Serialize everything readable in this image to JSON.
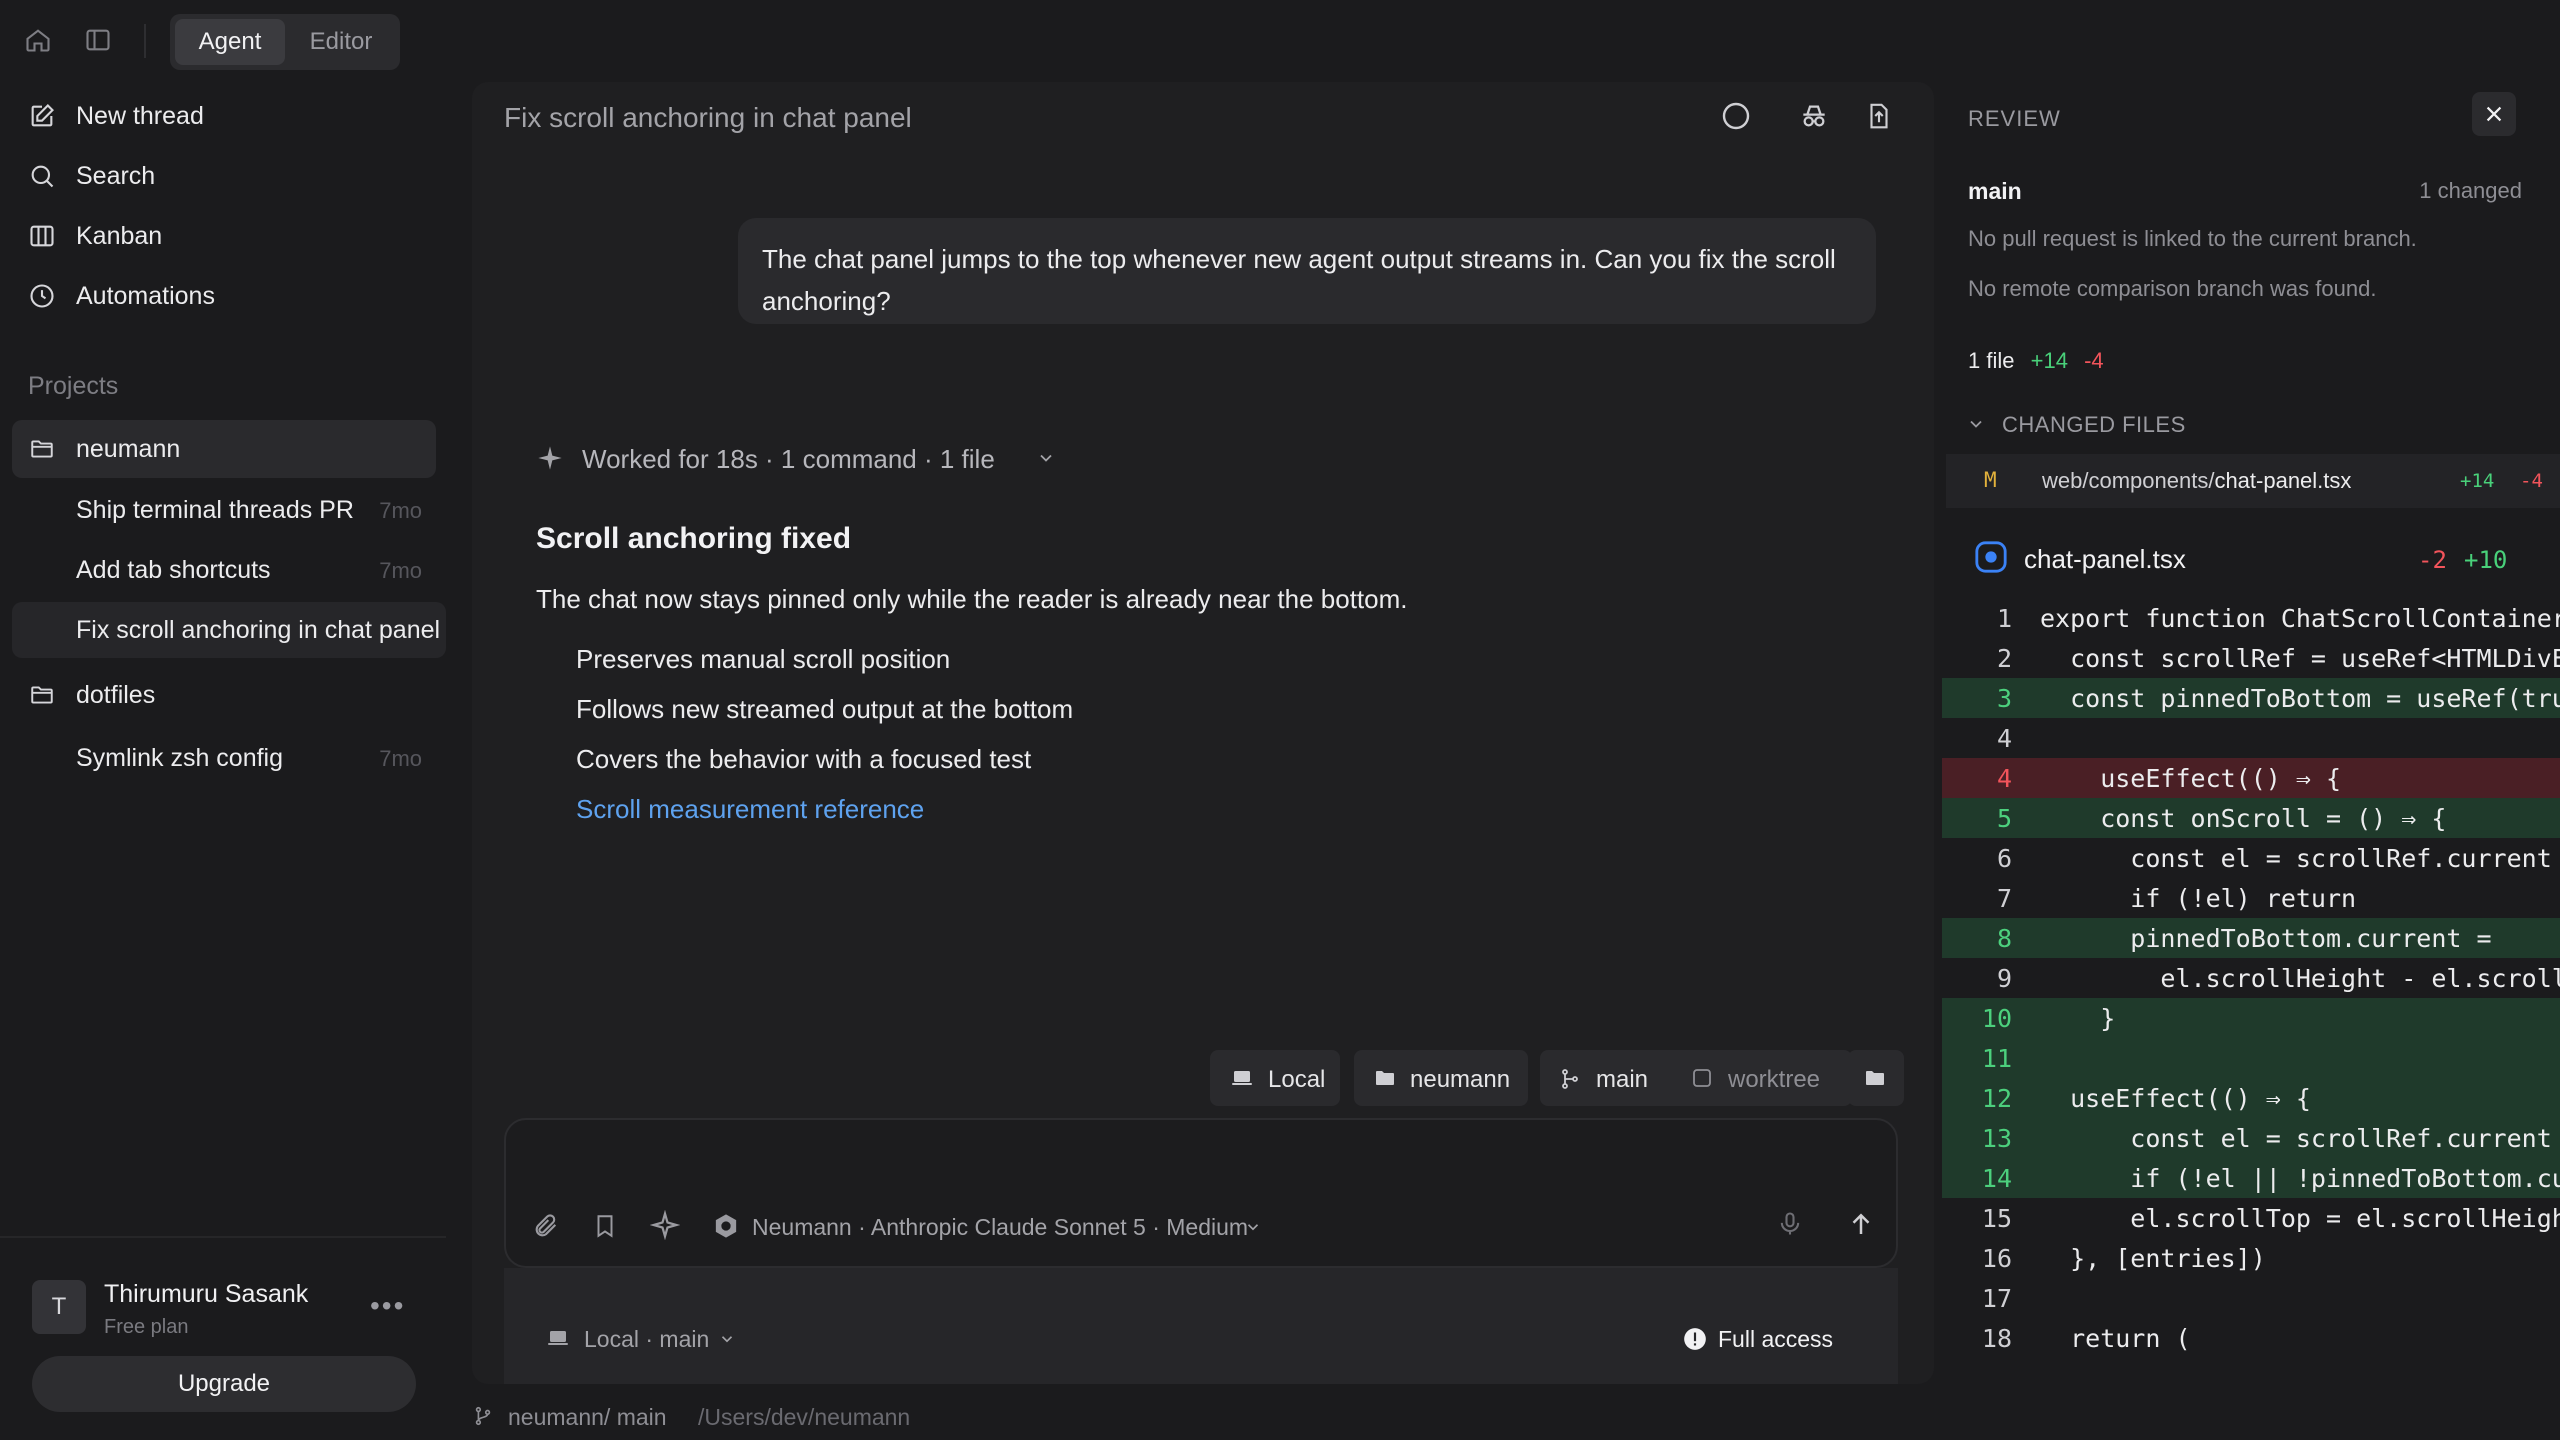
{
  "topbar": {
    "tabs": [
      "Agent",
      "Editor"
    ],
    "active_tab": "Agent"
  },
  "sidebar": {
    "nav": [
      {
        "label": "New thread",
        "icon": "compose-icon"
      },
      {
        "label": "Search",
        "icon": "search-icon"
      },
      {
        "label": "Kanban",
        "icon": "kanban-icon"
      },
      {
        "label": "Automations",
        "icon": "clock-icon"
      }
    ],
    "projects_heading": "Projects",
    "projects": [
      {
        "name": "neumann",
        "threads": [
          {
            "title": "Ship terminal threads PR",
            "age": "7mo"
          },
          {
            "title": "Add tab shortcuts",
            "age": "7mo"
          },
          {
            "title": "Fix scroll anchoring in chat panel",
            "age": ""
          }
        ]
      },
      {
        "name": "dotfiles",
        "threads": [
          {
            "title": "Symlink zsh config",
            "age": "7mo"
          }
        ]
      }
    ],
    "user": {
      "initial": "T",
      "name": "Thirumuru Sasank",
      "plan": "Free plan",
      "upgrade_label": "Upgrade"
    }
  },
  "main": {
    "title": "Fix scroll anchoring in chat panel",
    "user_message": "The chat panel jumps to the top whenever new agent output streams in. Can you fix the scroll anchoring?",
    "worked_summary": "Worked for 18s · 1 command · 1 file",
    "result_title": "Scroll anchoring fixed",
    "result_text": "The chat now stays pinned only while the reader is already near the bottom.",
    "bullets": [
      "Preserves manual scroll position",
      "Follows new streamed output at the bottom",
      "Covers the behavior with a focused test"
    ],
    "link_text": "Scroll measurement reference",
    "chips": {
      "local": "Local",
      "project": "neumann",
      "branch": "main",
      "worktree": "worktree"
    },
    "composer": {
      "model": "Neumann · Anthropic Claude Sonnet 5 · Medium",
      "env": "Local · main",
      "access": "Full access"
    }
  },
  "statusbar": {
    "branch": "neumann/ main",
    "path": "/Users/dev/neumann"
  },
  "review": {
    "heading": "REVIEW",
    "branch": "main",
    "changed_count": "1 changed",
    "no_pr": "No pull request is linked to the current branch.",
    "no_remote": "No remote comparison branch was found.",
    "files_count": "1 file",
    "additions": "+14",
    "deletions": "-4",
    "changed_files_heading": "CHANGED FILES",
    "file": {
      "status": "M",
      "dir": "web/components/",
      "name": "chat-panel.tsx",
      "add": "+14",
      "del": "-4"
    },
    "diff_file": {
      "name": "chat-panel.tsx",
      "del": "-2",
      "add": "+10"
    },
    "code": [
      {
        "n": "1",
        "t": "export function ChatScrollContainer",
        "k": ""
      },
      {
        "n": "2",
        "t": "  const scrollRef = useRef<HTMLDivElement>",
        "k": ""
      },
      {
        "n": "3",
        "t": "  const pinnedToBottom = useRef(true)",
        "k": "add"
      },
      {
        "n": "4",
        "t": "",
        "k": ""
      },
      {
        "n": "4",
        "t": "    useEffect(() ⇒ {",
        "k": "del"
      },
      {
        "n": "5",
        "t": "    const onScroll = () ⇒ {",
        "k": "add"
      },
      {
        "n": "6",
        "t": "      const el = scrollRef.current",
        "k": ""
      },
      {
        "n": "7",
        "t": "      if (!el) return",
        "k": ""
      },
      {
        "n": "8",
        "t": "      pinnedToBottom.current =",
        "k": "add"
      },
      {
        "n": "9",
        "t": "        el.scrollHeight - el.scrollTop",
        "k": ""
      },
      {
        "n": "10",
        "t": "    }",
        "k": "add"
      },
      {
        "n": "11",
        "t": "",
        "k": "add"
      },
      {
        "n": "12",
        "t": "  useEffect(() ⇒ {",
        "k": "add"
      },
      {
        "n": "13",
        "t": "      const el = scrollRef.current",
        "k": "add"
      },
      {
        "n": "14",
        "t": "      if (!el || !pinnedToBottom.current",
        "k": "add"
      },
      {
        "n": "15",
        "t": "      el.scrollTop = el.scrollHeight",
        "k": ""
      },
      {
        "n": "16",
        "t": "  }, [entries])",
        "k": ""
      },
      {
        "n": "17",
        "t": "",
        "k": ""
      },
      {
        "n": "18",
        "t": "  return (",
        "k": ""
      }
    ]
  }
}
